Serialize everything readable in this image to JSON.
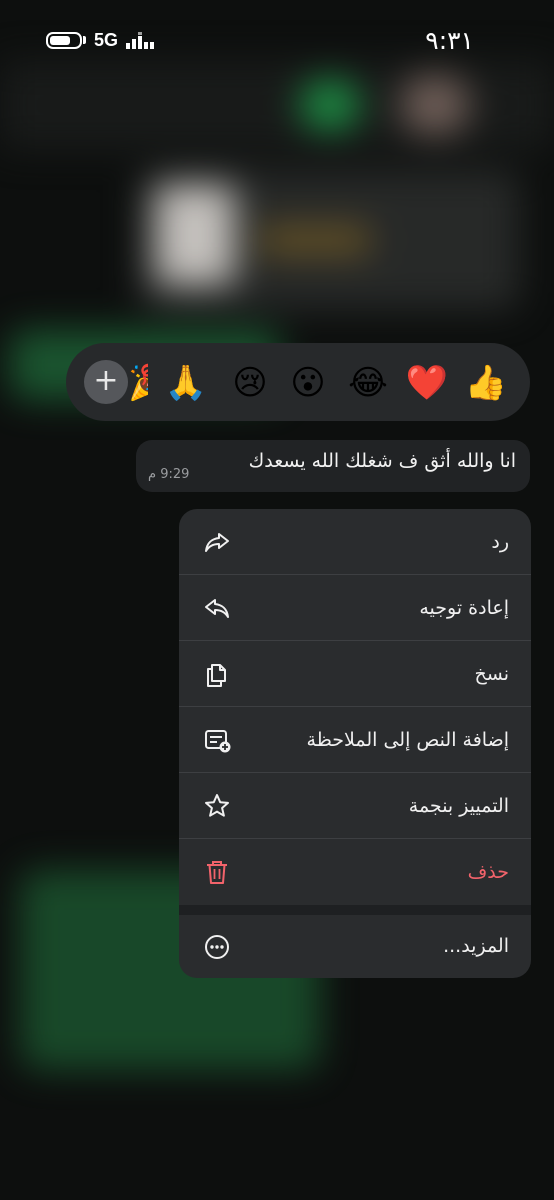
{
  "status_bar": {
    "time": "٩:٣١",
    "network": "5G",
    "battery_level": 0.7
  },
  "reactions": {
    "emojis": [
      "👍",
      "❤️",
      "😂",
      "😮",
      "😢",
      "🙏",
      "🎉"
    ],
    "add_button": "+"
  },
  "message": {
    "text": "انا والله أثق ف شغلك الله يسعدك",
    "time": "9:29 م"
  },
  "menu": {
    "items": [
      {
        "label": "رد",
        "icon": "reply-icon"
      },
      {
        "label": "إعادة توجيه",
        "icon": "forward-icon"
      },
      {
        "label": "نسخ",
        "icon": "copy-icon"
      },
      {
        "label": "إضافة النص إلى الملاحظة",
        "icon": "add-to-note-icon"
      },
      {
        "label": "التمييز بنجمة",
        "icon": "star-icon"
      },
      {
        "label": "حذف",
        "icon": "trash-icon"
      },
      {
        "label": "المزيد...",
        "icon": "more-icon"
      }
    ]
  },
  "colors": {
    "menu_bg": "#2a2c2e",
    "danger": "#f2636b",
    "reaction_bar_bg": "#27292b"
  }
}
